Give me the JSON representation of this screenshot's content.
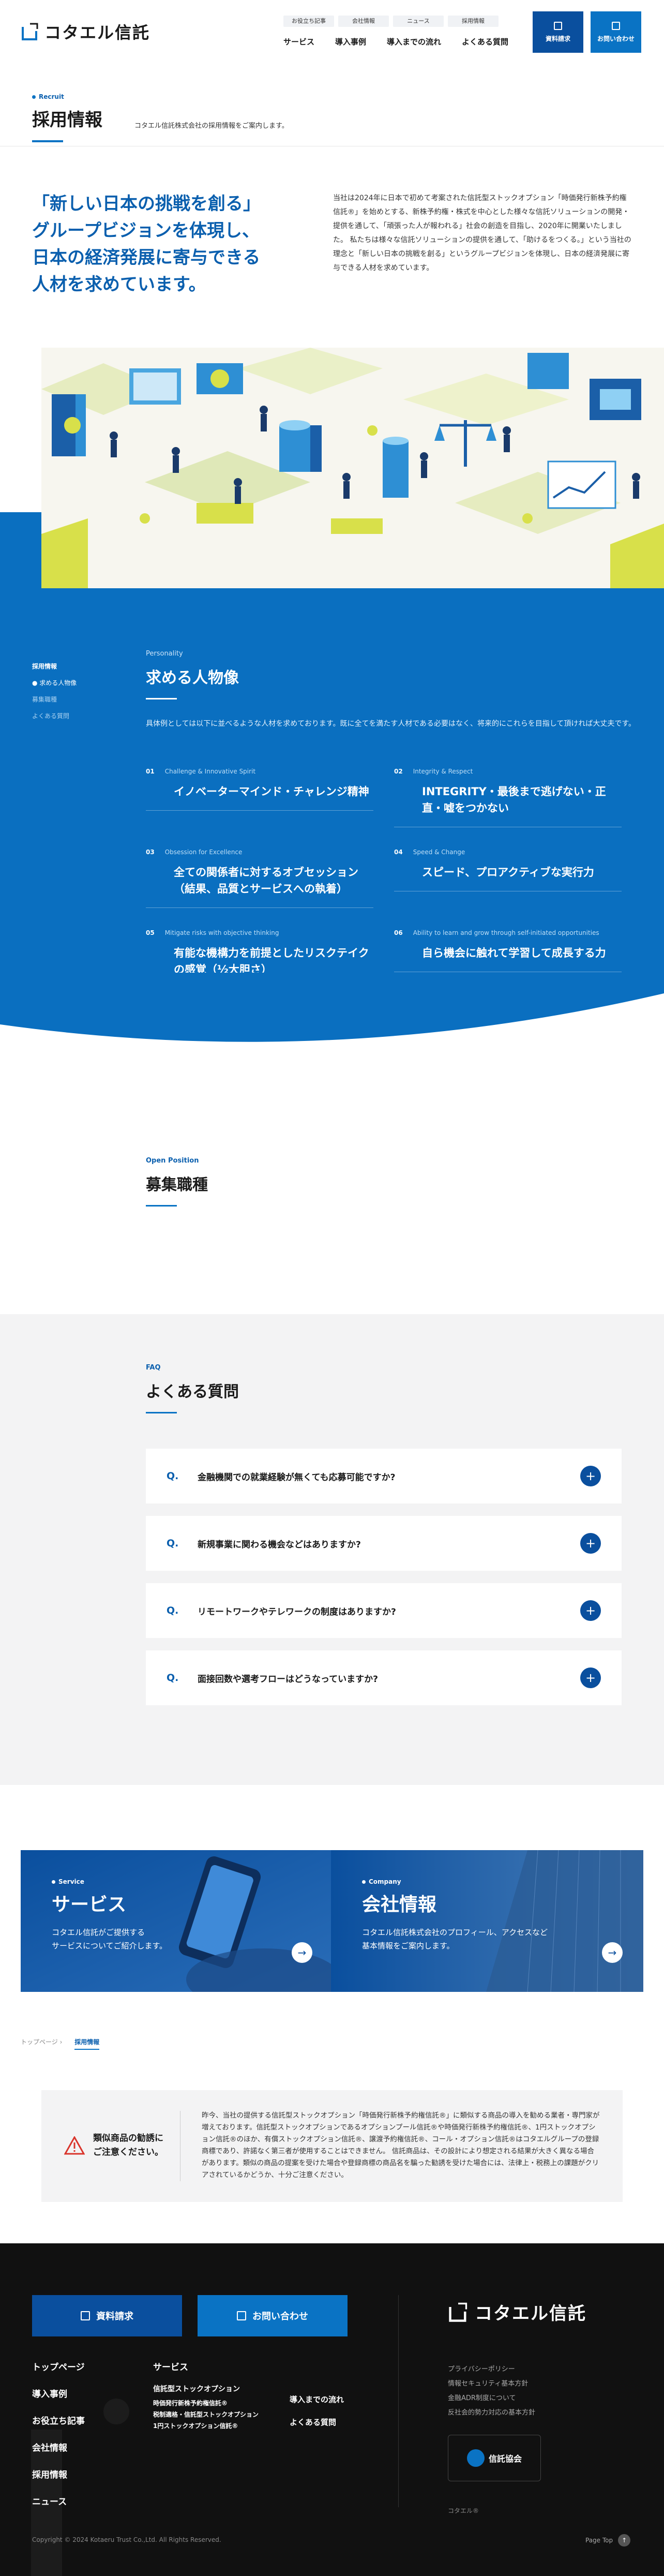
{
  "header": {
    "logo_text": "コタエル信託",
    "utility_links": [
      "お役立ち記事",
      "会社情報",
      "ニュース",
      "採用情報"
    ],
    "nav": [
      "サービス",
      "導入事例",
      "導入までの流れ",
      "よくある質問"
    ],
    "doc_button": "資料請求",
    "contact_button": "お問い合わせ"
  },
  "page": {
    "en_label": "Recruit",
    "title": "採用情報",
    "subtitle": "コタエル信託株式会社の採用情報をご案内します。"
  },
  "lead": {
    "headline": "「新しい日本の挑戦を創る」\nグループビジョンを体現し、\n日本の経済発展に寄与できる\n人材を求めています。",
    "body": "当社は2024年に日本で初めて考案された信託型ストックオプション「時価発行新株予約権信託®」を始めとする、新株予約権・株式を中心とした様々な信託ソリューションの開発・提供を通して、「頑張った人が報われる」社会の創造を目指し、2020年に開業いたしました。 私たちは様々な信託ソリューションの提供を通して、「助けるをつくる。」という当社の理念と「新しい日本の挑戦を創る」というグループビジョンを体現し、日本の経済発展に寄与できる人材を求めています。"
  },
  "sidebar": {
    "items": [
      "採用情報",
      "求める人物像",
      "募集職種",
      "よくある質問"
    ]
  },
  "personality": {
    "en": "Personality",
    "title": "求める人物像",
    "desc": "具体例としては以下に並べるような人材を求めております。既に全てを満たす人材である必要はなく、将来的にこれらを目指して頂ければ大丈夫です。",
    "items": [
      {
        "num": "01",
        "en": "Challenge & Innovative Spirit",
        "title": "イノベーターマインド・チャレンジ精神"
      },
      {
        "num": "02",
        "en": "Integrity & Respect",
        "title": "INTEGRITY・最後まで逃げない・正直・嘘をつかない"
      },
      {
        "num": "03",
        "en": "Obsession for Excellence",
        "title": "全ての関係者に対するオブセッション（結果、品質とサービスへの執着）"
      },
      {
        "num": "04",
        "en": "Speed & Change",
        "title": "スピード、プロアクティブな実行力"
      },
      {
        "num": "05",
        "en": "Mitigate risks with objective thinking",
        "title": "有能な機構力を前提としたリスクテイクの感覚（½大胆さ）"
      },
      {
        "num": "06",
        "en": "Ability to learn and grow through self-initiated opportunities",
        "title": "自ら機会に触れて学習して成長する力"
      }
    ]
  },
  "open_position": {
    "en": "Open Position",
    "title": "募集職種"
  },
  "faq": {
    "en": "FAQ",
    "title": "よくある質問",
    "q_mark": "Q.",
    "plus": "+",
    "items": [
      "金融機関での就業経験が無くても応募可能ですか?",
      "新規事業に関わる機会などはありますか?",
      "リモートワークやテレワークの制度はありますか?",
      "面接回数や選考フローはどうなっていますか?"
    ]
  },
  "cards": [
    {
      "en": "Service",
      "title": "サービス",
      "desc": "コタエル信託がご提供する\nサービスについてご紹介します。"
    },
    {
      "en": "Company",
      "title": "会社情報",
      "desc": "コタエル信託株式会社のプロフィール、アクセスなど\n基本情報をご案内します。"
    }
  ],
  "arrow": "→",
  "breadcrumb": [
    "トップページ",
    "採用情報"
  ],
  "warning": {
    "title": "類似商品の勧誘に\nご注意ください。",
    "body": "昨今、当社の提供する信託型ストックオプション「時価発行新株予約権信託®」に類似する商品の導入を勧める業者・専門家が増えております。信託型ストックオプションであるオプションプール信託®や時価発行新株予約権信託®、1円ストックオプション信託®のほか、有償ストックオプション信託®、譲渡予約権信託®、コール・オプション信託®はコタエルグループの登録商標であり、許諾なく第三者が使用することはできません。 信託商品は、その設計により想定される結果が大きく異なる場合があります。類似の商品の提案を受けた場合や登録商標の商品名を騙った勧誘を受けた場合には、法律上・税務上の課題がクリアされているかどうか、十分ご注意ください。"
  },
  "footer": {
    "doc_button": "資料請求",
    "contact_button": "お問い合わせ",
    "col1": [
      "トップページ",
      "導入事例",
      "お役立ち記事",
      "会社情報",
      "採用情報",
      "ニュース"
    ],
    "col2_title": "サービス",
    "col2": [
      "信託型ストックオプション",
      "時価発行新株予約権信託®",
      "税制適格・信託型ストックオプション",
      "1円ストックオプション信託®"
    ],
    "col3": [
      "導入までの流れ",
      "よくある質問"
    ],
    "logo_text": "コタエル信託",
    "links": [
      "プライバシーポリシー",
      "情報セキュリティ基本方針",
      "金融ADR制度について",
      "反社会的勢力対応の基本方針"
    ],
    "assoc_name": "信託協会",
    "tag": "コタエル®",
    "copyright": "Copyright © 2024 Kotaeru Trust Co.,Ltd. All Rights Reserved.",
    "page_top": "Page Top",
    "page_top_arrow": "↑"
  },
  "colors": {
    "primary": "#0a4f9e",
    "accent": "#0a73c4",
    "lime": "#d8e04a"
  }
}
